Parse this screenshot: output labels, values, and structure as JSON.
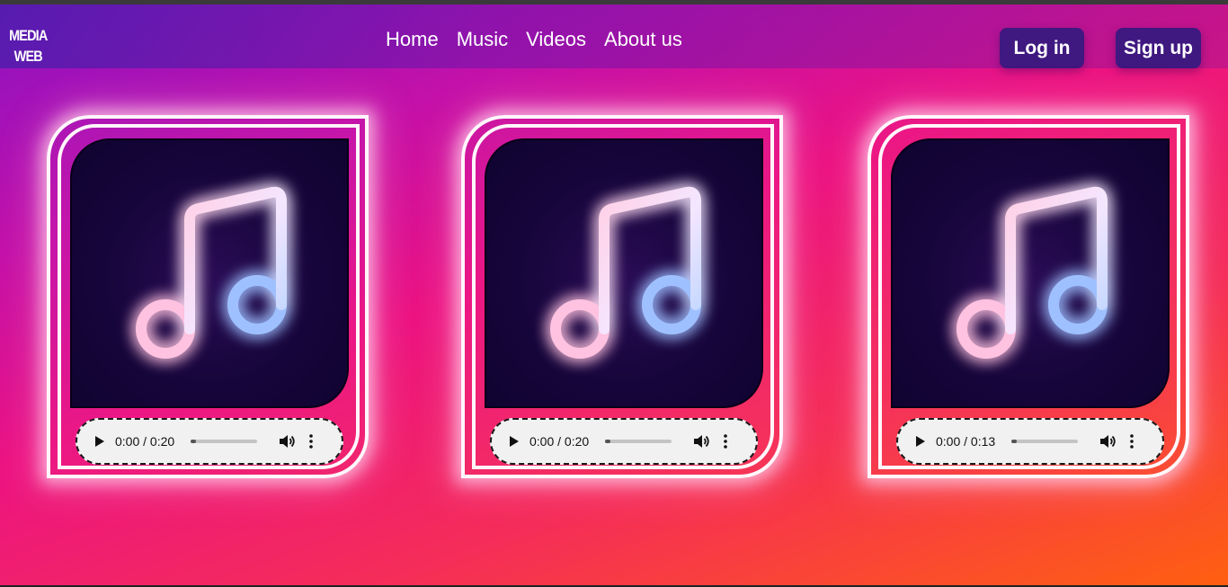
{
  "logo": {
    "line1": "MEDIA",
    "line2": "WEB"
  },
  "nav": {
    "items": [
      {
        "label": "Home"
      },
      {
        "label": "Music"
      },
      {
        "label": "Videos"
      },
      {
        "label": "About us"
      }
    ]
  },
  "auth": {
    "login_label": "Log in",
    "signup_label": "Sign up"
  },
  "cards": [
    {
      "icon": "music-note-icon",
      "time": "0:00 / 0:20",
      "progress": 0.0
    },
    {
      "icon": "music-note-icon",
      "time": "0:00 / 0:20",
      "progress": 0.0
    },
    {
      "icon": "music-note-icon",
      "time": "0:00 / 0:13",
      "progress": 0.0
    }
  ],
  "colors": {
    "button_bg": "#3f1880",
    "card_border": "#fff6fb",
    "note_pink": "#ffb3d9",
    "note_blue": "#2f6bff"
  }
}
